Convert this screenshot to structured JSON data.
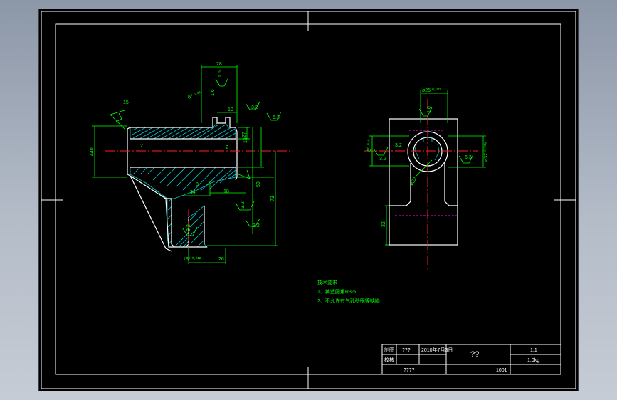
{
  "colors": {
    "background": "#000000",
    "frame": "#ffffff",
    "outline": "#ffffff",
    "dimension": "#00ff00",
    "centerline": "#ff2020",
    "hatch": "#00c8d4",
    "hidden": "#ff00ff",
    "notes": "#00ff00"
  },
  "left_view": {
    "dims": {
      "d28": "28",
      "r1_6a": "1.6",
      "r1_6b": "1.6",
      "tol_top": "6⁰ ⁰·⁰³",
      "d10": "10",
      "r3_2a": "3.2",
      "r6_3": "6.3",
      "a15": "15",
      "d27": "27",
      "d19": "19",
      "d440": "440",
      "d2a": "2",
      "d2b": "2",
      "d8": "8",
      "d34": "34",
      "d18": "18",
      "d50": "50",
      "d73": "73",
      "r3_2b": "3.2",
      "r3_2c": "3.2",
      "r3_2d": "3.2",
      "tol_bot": "18⁰ ⁰·⁰¹²",
      "d26": "26"
    }
  },
  "right_view": {
    "dims": {
      "d25": "ø25 ⁰·⁰²³",
      "r1_6": "1.6",
      "tol_left": "6⁰·⁰⁴⁸",
      "r3_2a": "3.2",
      "r3_2b": "3.2",
      "r6_3": "6.3",
      "d32": "ø32 ⁰·⁰³⁹",
      "d32b": "ø32",
      "d32c": "32"
    }
  },
  "notes": {
    "title": "技术要求",
    "line1": "1、铸造圆角R3-5",
    "line2": "2、不允许有气孔砂眼等缺陷"
  },
  "title_block": {
    "label_draw": "制图",
    "label_check": "校核",
    "name": "???",
    "date": "2010年7月3日",
    "part_name": "??",
    "scale": "1:1",
    "weight": "1.0kg",
    "school": "????",
    "drawing_no": "1001"
  }
}
